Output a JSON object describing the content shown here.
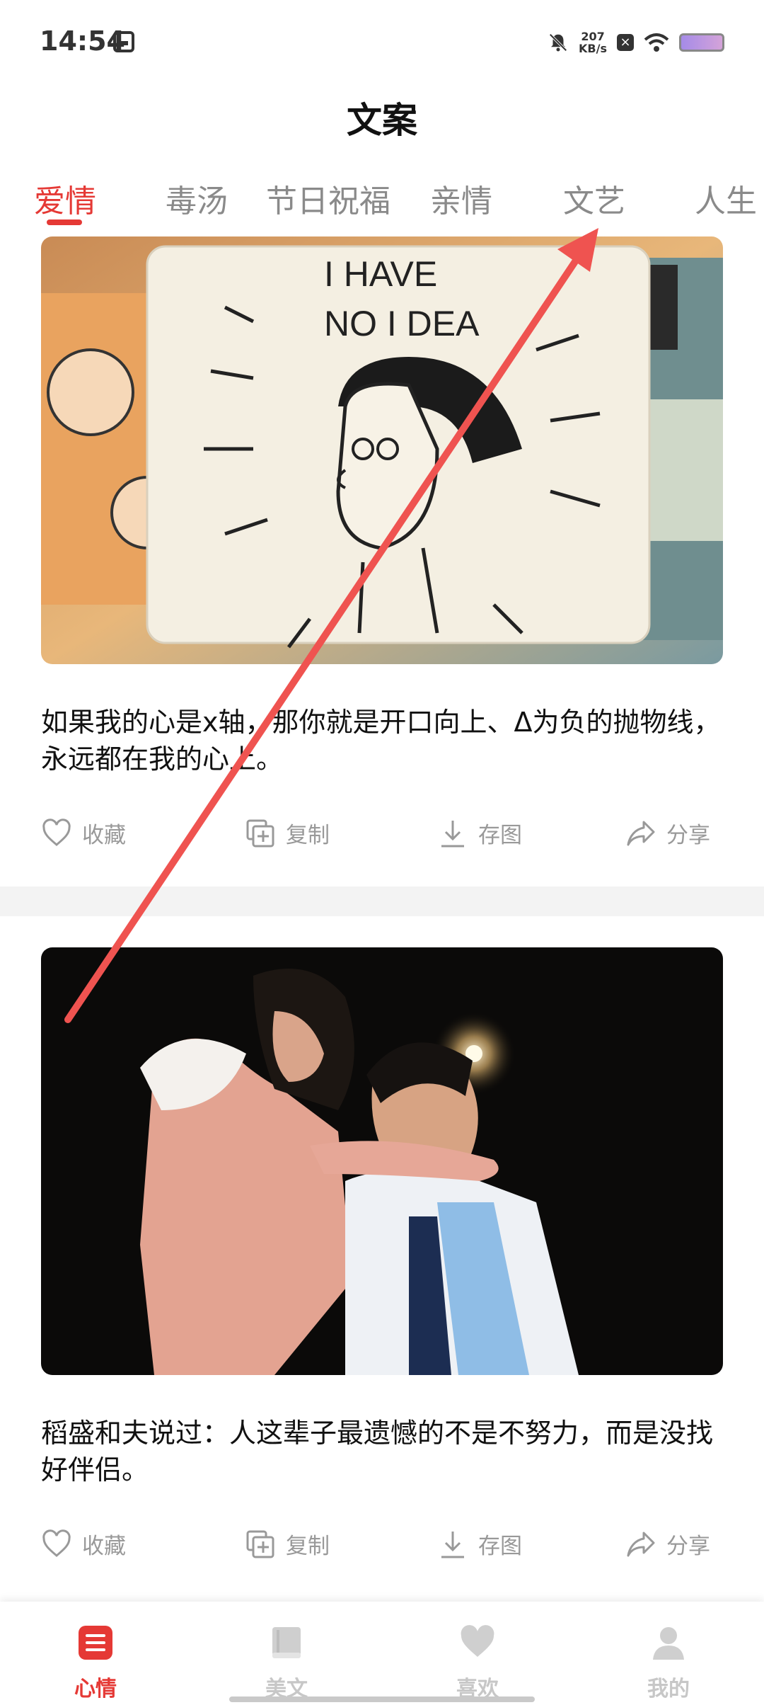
{
  "status_bar": {
    "time": "14:54",
    "net_speed_value": "207",
    "net_speed_unit": "KB/s"
  },
  "header": {
    "title": "文案"
  },
  "tabs": [
    {
      "label": "爱情",
      "active": true
    },
    {
      "label": "毒汤"
    },
    {
      "label": "节日祝福"
    },
    {
      "label": "亲情"
    },
    {
      "label": "文艺"
    },
    {
      "label": "人生"
    }
  ],
  "cards": [
    {
      "image_text_line1": "I HAVE",
      "image_text_line2": "NO I DEA",
      "text": "如果我的心是x轴，那你就是开口向上、Δ为负的抛物线，永远都在我的心上。",
      "actions": {
        "favorite": "收藏",
        "copy": "复制",
        "save_image": "存图",
        "share": "分享"
      }
    },
    {
      "text": "稻盛和夫说过：人这辈子最遗憾的不是不努力，而是没找好伴侣。",
      "actions": {
        "favorite": "收藏",
        "copy": "复制",
        "save_image": "存图",
        "share": "分享"
      }
    }
  ],
  "bottom_nav": [
    {
      "label": "心情",
      "icon": "mood-icon",
      "active": true
    },
    {
      "label": "美文",
      "icon": "book-icon"
    },
    {
      "label": "喜欢",
      "icon": "heart-icon"
    },
    {
      "label": "我的",
      "icon": "person-icon"
    }
  ],
  "colors": {
    "accent": "#e53935",
    "inactive": "#c7c7c7",
    "arrow": "#ef5350"
  }
}
